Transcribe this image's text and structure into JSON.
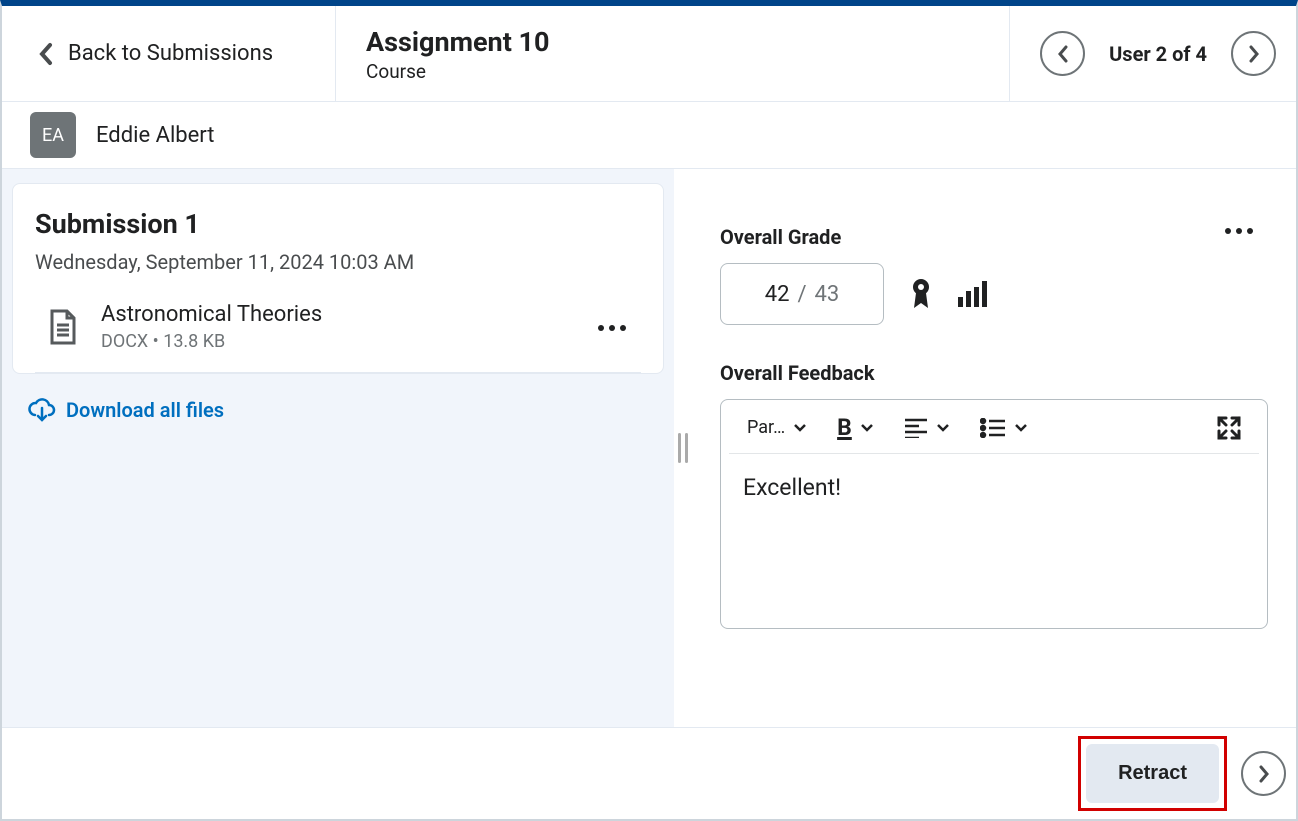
{
  "header": {
    "back_label": "Back to Submissions",
    "title": "Assignment 10",
    "subtitle": "Course",
    "user_counter": "User 2 of 4"
  },
  "user": {
    "initials": "EA",
    "name": "Eddie Albert"
  },
  "submission": {
    "title": "Submission 1",
    "timestamp": "Wednesday, September 11, 2024 10:03 AM",
    "file": {
      "name": "Astronomical Theories",
      "meta": "DOCX   •   13.8 KB"
    },
    "download_label": "Download all files"
  },
  "grading": {
    "overall_label": "Overall Grade",
    "earned": "42",
    "out_of": "43"
  },
  "feedback": {
    "label": "Overall Feedback",
    "paragraph_selector": "Par…",
    "body": "Excellent!"
  },
  "footer": {
    "retract_label": "Retract"
  }
}
